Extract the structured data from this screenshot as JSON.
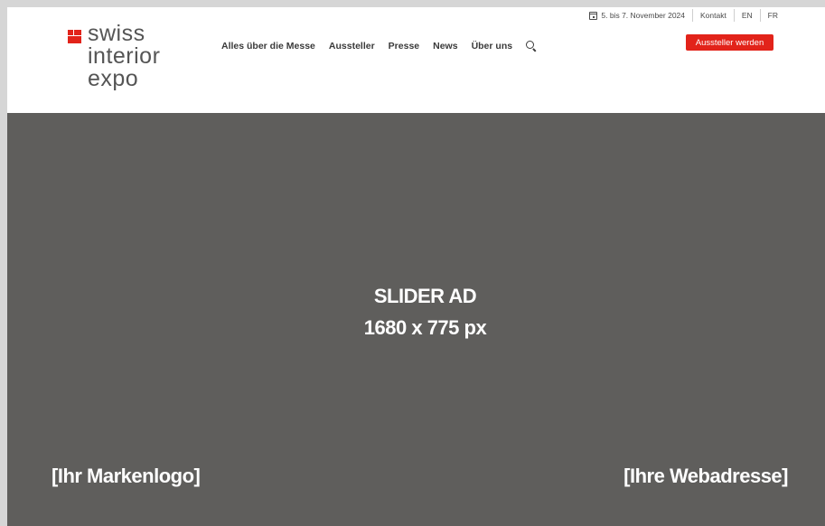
{
  "logo": {
    "line1": "swiss",
    "line2": "interior",
    "line3": "expo",
    "accent_color": "#e2231a"
  },
  "nav": {
    "items": [
      "Alles über die Messe",
      "Aussteller",
      "Presse",
      "News",
      "Über uns"
    ],
    "search_icon": "search-icon"
  },
  "topbar": {
    "date": "5. bis 7. November 2024",
    "contact": "Kontakt",
    "lang_en": "EN",
    "lang_fr": "FR",
    "calendar_icon": "calendar-icon"
  },
  "cta": {
    "label": "Aussteller werden",
    "color": "#e2231a"
  },
  "slider": {
    "title_line1": "SLIDER AD",
    "title_line2": "1680 x 775 px",
    "left_text": "[Ihr Markenlogo]",
    "right_text": "[Ihre Webadresse]",
    "background": "#5f5e5c"
  }
}
